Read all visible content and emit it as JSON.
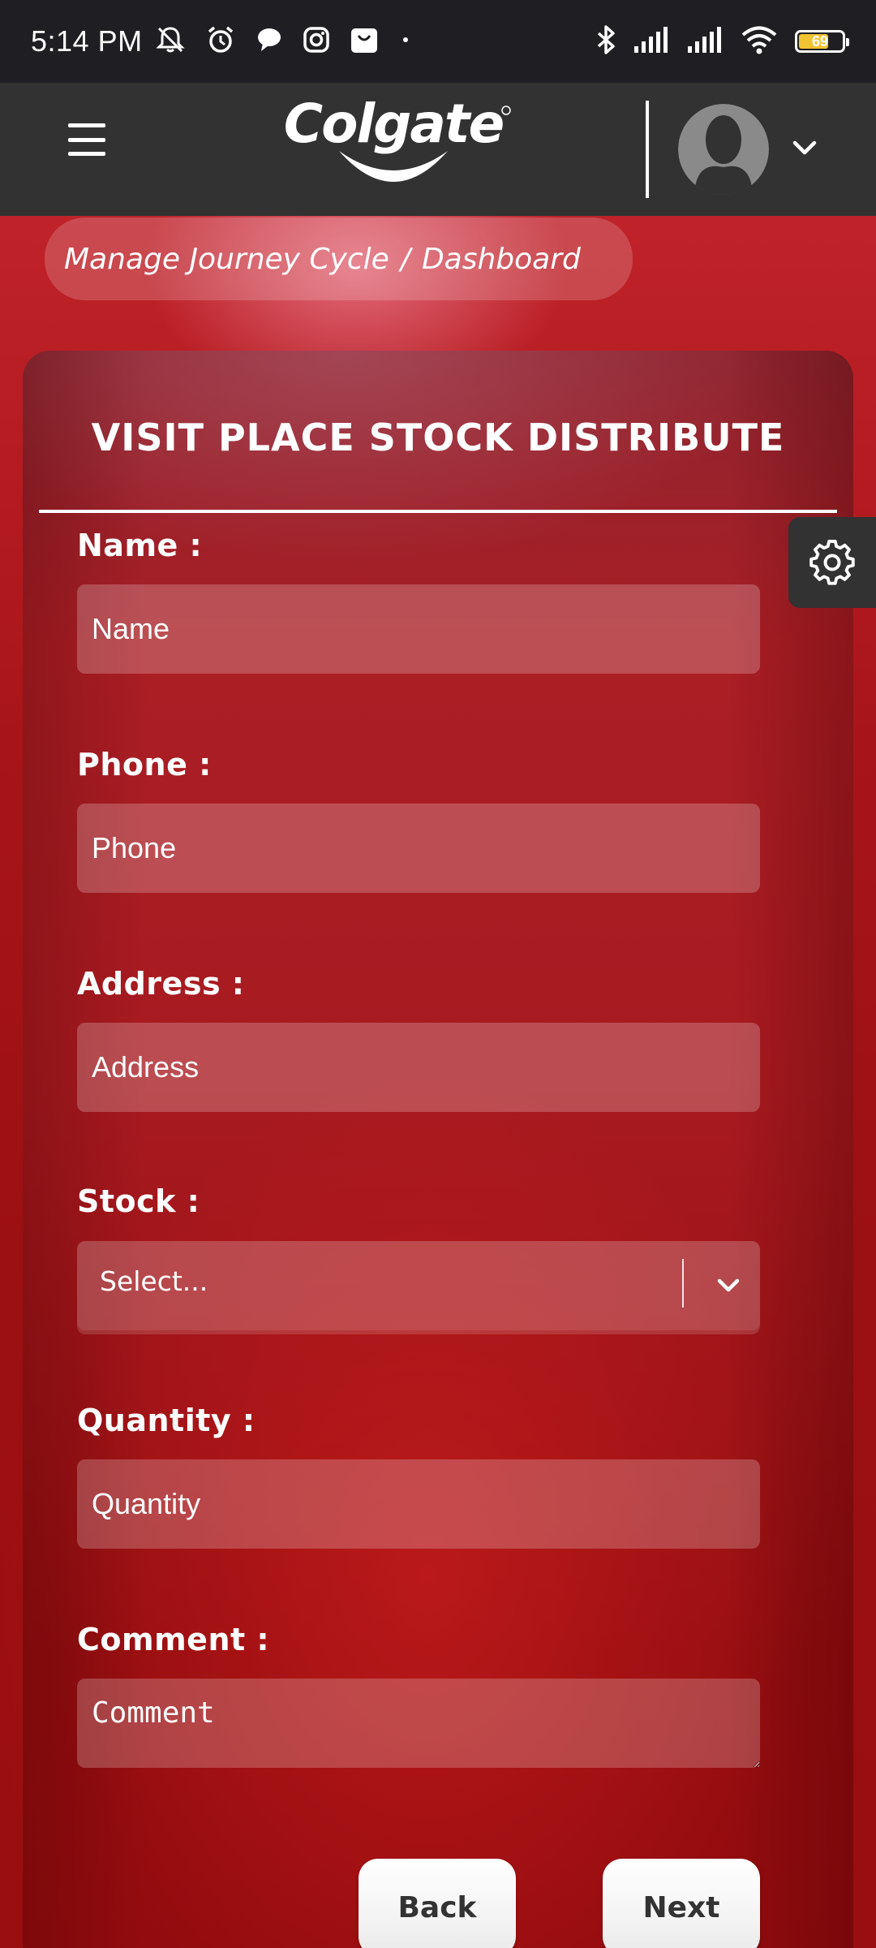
{
  "status_bar": {
    "time": "5:14 PM",
    "battery_level": "69",
    "battery_fraction": 0.69,
    "left_icons": [
      "mute-bell-icon",
      "alarm-icon",
      "chat-bubble-icon",
      "instagram-icon",
      "shopping-bag-icon",
      "dot-icon"
    ],
    "right_icons": [
      "bluetooth-icon",
      "signal-icon",
      "signal-icon",
      "wifi-icon",
      "battery-icon"
    ]
  },
  "header": {
    "brand": "Colgate",
    "menu_icon": "hamburger-icon",
    "avatar_icon": "user-avatar-icon",
    "caret_icon": "chevron-down-icon"
  },
  "breadcrumb": {
    "items": [
      "Manage Journey Cycle",
      "Dashboard"
    ],
    "separator": "/"
  },
  "form": {
    "title": "VISIT PLACE STOCK DISTRIBUTE",
    "fields": {
      "name": {
        "label": "Name :",
        "placeholder": "Name",
        "value": ""
      },
      "phone": {
        "label": "Phone :",
        "placeholder": "Phone",
        "value": ""
      },
      "address": {
        "label": "Address :",
        "placeholder": "Address",
        "value": ""
      },
      "stock": {
        "label": "Stock :",
        "selected": "Select..."
      },
      "quantity": {
        "label": "Quantity :",
        "placeholder": "Quantity",
        "value": ""
      },
      "comment": {
        "label": "Comment :",
        "placeholder": "Comment",
        "value": ""
      }
    },
    "buttons": {
      "back": "Back",
      "next": "Next"
    }
  },
  "settings": {
    "icon": "gear-icon"
  },
  "colors": {
    "status_bar_bg": "#1f1f23",
    "header_bg": "#323232",
    "brand_red": "#a8161b",
    "battery_fill": "#f1c232"
  }
}
